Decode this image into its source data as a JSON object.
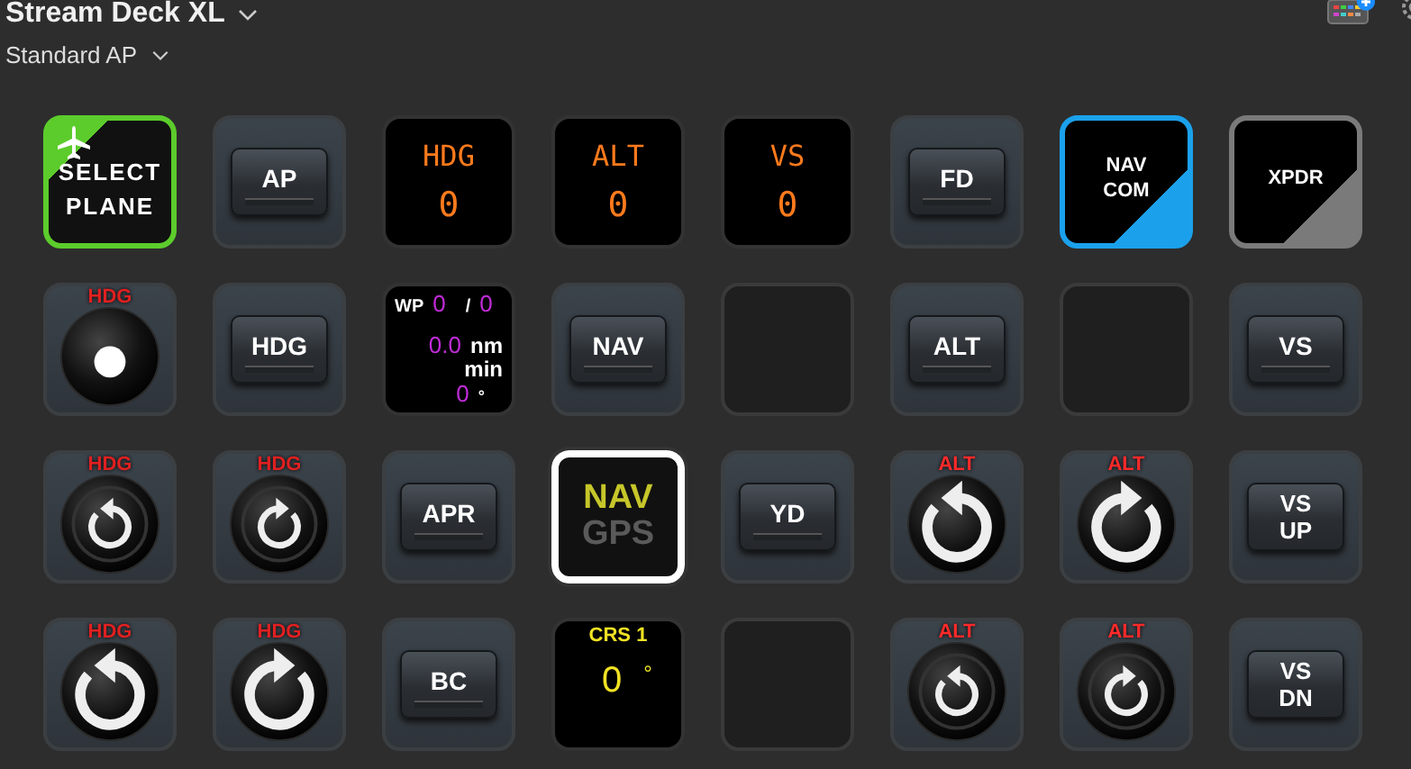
{
  "header": {
    "device": "Stream Deck XL",
    "profile": "Standard AP"
  },
  "keys": [
    {
      "kind": "plane",
      "lines": [
        "SELECT",
        "PLANE"
      ]
    },
    {
      "kind": "button",
      "lines": [
        "AP"
      ]
    },
    {
      "kind": "display",
      "title": "HDG",
      "value": "0"
    },
    {
      "kind": "display",
      "title": "ALT",
      "value": "0"
    },
    {
      "kind": "display",
      "title": "VS",
      "value": "0"
    },
    {
      "kind": "button",
      "lines": [
        "FD"
      ]
    },
    {
      "kind": "corner",
      "lines": [
        "NAV",
        "COM"
      ],
      "color": "#1ba1ec"
    },
    {
      "kind": "corner",
      "lines": [
        "XPDR"
      ],
      "color": "#7a7a7a"
    },
    {
      "kind": "dial",
      "label": "HDG",
      "color": "#e02020"
    },
    {
      "kind": "button",
      "lines": [
        "HDG"
      ]
    },
    {
      "kind": "waypoint",
      "label": "WP",
      "index": "0",
      "separator": "/",
      "total": "0",
      "distance": "0.0",
      "unit": "nm",
      "time_unit": "min",
      "bearing": "0",
      "degree": "°"
    },
    {
      "kind": "button",
      "lines": [
        "NAV"
      ]
    },
    {
      "kind": "empty"
    },
    {
      "kind": "button",
      "lines": [
        "ALT"
      ]
    },
    {
      "kind": "empty"
    },
    {
      "kind": "button",
      "lines": [
        "VS"
      ]
    },
    {
      "kind": "knob",
      "label": "HDG",
      "color": "#e02020",
      "clockwise": false,
      "large": false
    },
    {
      "kind": "knob",
      "label": "HDG",
      "color": "#e02020",
      "clockwise": true,
      "large": false
    },
    {
      "kind": "button",
      "lines": [
        "APR"
      ]
    },
    {
      "kind": "navgps",
      "top": "NAV",
      "bottom": "GPS"
    },
    {
      "kind": "button",
      "lines": [
        "YD"
      ]
    },
    {
      "kind": "knob",
      "label": "ALT",
      "color": "#ff2a2a",
      "clockwise": false,
      "large": true
    },
    {
      "kind": "knob",
      "label": "ALT",
      "color": "#ff2a2a",
      "clockwise": true,
      "large": true
    },
    {
      "kind": "button",
      "lines": [
        "VS",
        "UP"
      ]
    },
    {
      "kind": "knob",
      "label": "HDG",
      "color": "#e02020",
      "clockwise": false,
      "large": true
    },
    {
      "kind": "knob",
      "label": "HDG",
      "color": "#e02020",
      "clockwise": true,
      "large": true
    },
    {
      "kind": "button",
      "lines": [
        "BC"
      ]
    },
    {
      "kind": "crs",
      "title": "CRS 1",
      "value": "0",
      "degree": "°"
    },
    {
      "kind": "empty"
    },
    {
      "kind": "knob",
      "label": "ALT",
      "color": "#ff2a2a",
      "clockwise": false,
      "large": false
    },
    {
      "kind": "knob",
      "label": "ALT",
      "color": "#ff2a2a",
      "clockwise": true,
      "large": false
    },
    {
      "kind": "button",
      "lines": [
        "VS",
        "DN"
      ]
    }
  ]
}
